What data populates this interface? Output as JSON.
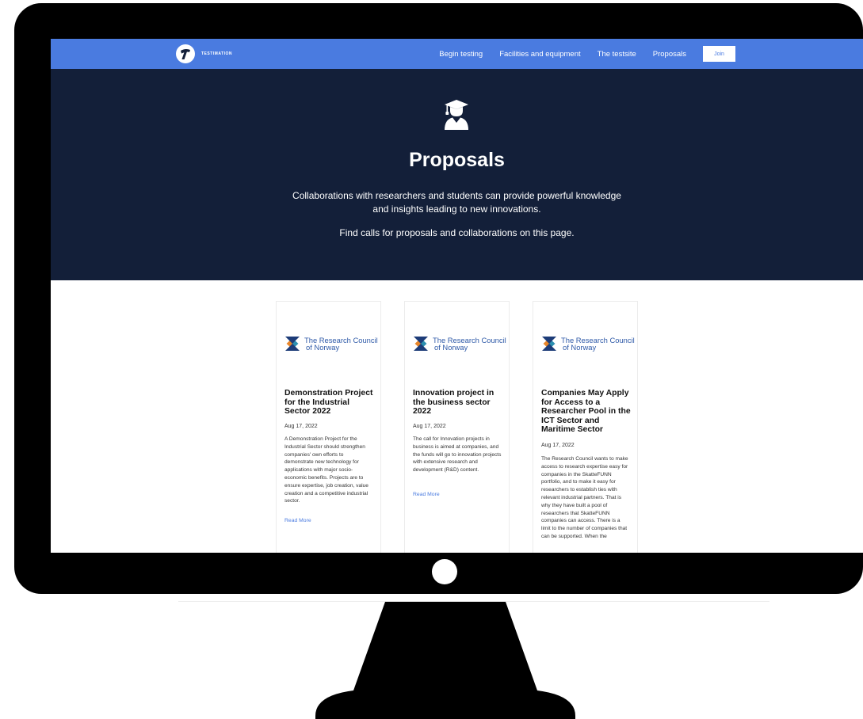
{
  "brand": {
    "name": "TESTIMATION"
  },
  "nav": {
    "links": [
      "Begin testing",
      "Facilities and equipment",
      "The testsite",
      "Proposals"
    ],
    "join_label": "Join"
  },
  "hero": {
    "icon": "graduate-icon",
    "title": "Proposals",
    "description": "Collaborations with researchers and students can provide powerful knowledge and insights leading to new innovations.",
    "subtext": "Find calls for proposals and collaborations on this page."
  },
  "cards": [
    {
      "logo_line1": "The Research Council",
      "logo_line2": "of Norway",
      "title": "Demonstration Project for the Industrial Sector 2022",
      "date": "Aug 17, 2022",
      "excerpt": "A Demonstration Project for the Industrial Sector should strengthen companies' own efforts to demonstrate new technology for applications with major socio-economic benefits. Projects are to ensure expertise, job creation, value creation and a competitive industrial sector.",
      "read_more": "Read More"
    },
    {
      "logo_line1": "The Research Council",
      "logo_line2": "of Norway",
      "title": "Innovation project in the business sector 2022",
      "date": "Aug 17, 2022",
      "excerpt": "The call for Innovation projects in business is aimed at companies, and the funds will go to innovation projects with extensive research and development (R&D) content.",
      "read_more": "Read More"
    },
    {
      "logo_line1": "The Research Council",
      "logo_line2": "of Norway",
      "title": "Companies May Apply for Access to a Researcher Pool in the ICT Sector and Maritime Sector",
      "date": "Aug 17, 2022",
      "excerpt": "The Research Council wants to make access to research expertise easy for companies in the SkatteFUNN portfolio, and to make it easy for researchers to establish ties with relevant industrial partners. That is why they have built a pool of researchers that SkatteFUNN companies can access. There is a limit to the number of companies that can be supported. When the",
      "read_more": "Read More"
    }
  ],
  "colors": {
    "nav_bg": "#4a7be0",
    "hero_bg": "#131f39",
    "link": "#4a7be0",
    "logo_text": "#2f5aa8",
    "logo_orange": "#e8862a",
    "logo_teal": "#2c8fb0",
    "logo_navy": "#1d3c78"
  }
}
